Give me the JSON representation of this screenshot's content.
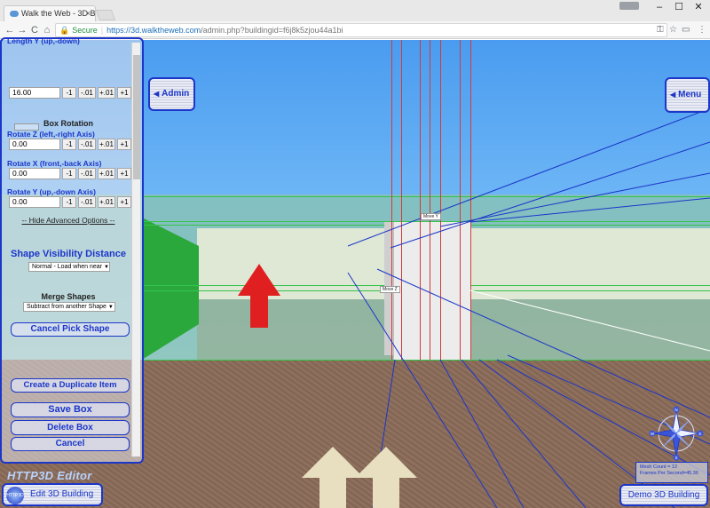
{
  "browser": {
    "tab_title": "Walk the Web - 3D Buildi",
    "tab_close": "×",
    "window_controls": [
      "–",
      "☐",
      "✕"
    ],
    "nav_icons": [
      "back-icon",
      "forward-icon",
      "reload-icon",
      "home-icon"
    ],
    "nav_glyphs": [
      "←",
      "→",
      "C",
      "⌂"
    ],
    "secure_label": "Secure",
    "url_host": "https://3d.walktheweb.com",
    "url_path": "/admin.php?buildingid=f6j8k5zjou44a1bi"
  },
  "scene": {
    "move_labels": [
      "Move Y",
      "Move Z"
    ],
    "colors": {
      "accent": "#1b36c9",
      "sky": "#6ab3f5",
      "ground": "#8a6a57",
      "box_green": "#2aa83c",
      "arrow_red": "#e02020",
      "arrow_cream": "#e8dfc0"
    }
  },
  "panel": {
    "length_label": "Length Y (up,-down)",
    "length_value": "16.00",
    "select_box_stub": "Select Box",
    "box_rotation_heading": "Box Rotation",
    "rotate_z_label": "Rotate Z (left,-right Axis)",
    "rotate_z_value": "0.00",
    "rotate_x_label": "Rotate X (front,-back Axis)",
    "rotate_x_value": "0.00",
    "rotate_y_label": "Rotate Y (up,-down Axis)",
    "rotate_y_value": "0.00",
    "step_buttons": [
      "-1",
      "-.01",
      "+.01",
      "+1"
    ],
    "hide_advanced": "-- Hide Advanced Options --",
    "shape_visibility_title": "Shape Visibility Distance",
    "shape_visibility_value": "Normal - Load when near",
    "merge_shapes_heading": "Merge Shapes",
    "merge_shapes_value": "Subtract from another Shape",
    "cancel_pick_shape": "Cancel Pick Shape",
    "create_duplicate": "Create a Duplicate Item",
    "save_box": "Save Box",
    "delete_box": "Delete Box",
    "cancel": "Cancel"
  },
  "overlay": {
    "admin_label": "Admin",
    "menu_label": "Menu",
    "stats_mesh": "Mesh Count = 12",
    "stats_fps": "Frames Per Second=45.36",
    "logo_text": "HTTP3D Editor",
    "logo_icon_text": "HTTP3D",
    "edit_building": "Edit 3D Building",
    "demo_building": "Demo 3D Building",
    "compass_letters": [
      "N",
      "S",
      "E",
      "W"
    ]
  }
}
